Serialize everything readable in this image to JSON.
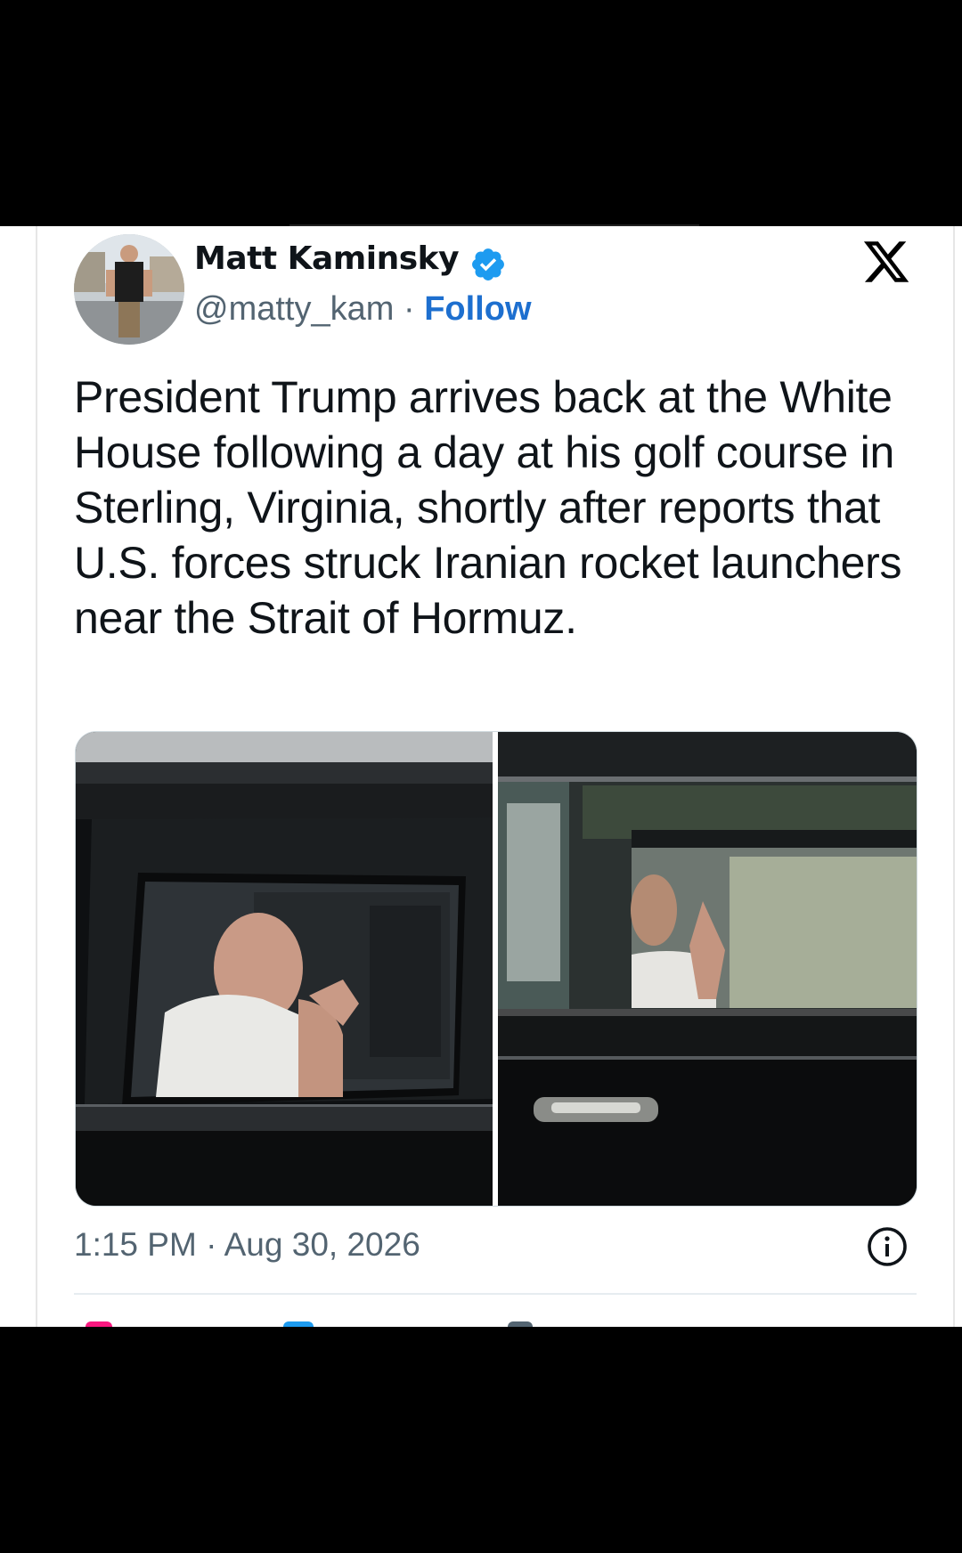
{
  "tweet": {
    "author_name": "Matt Kaminsky",
    "handle": "@matty_kam",
    "separator": "·",
    "follow_label": "Follow",
    "text": "President Trump arrives back at the White House following a day at his golf course in Sterling, Virginia, shortly after reports that U.S. forces struck Iranian rocket launchers near the Strait of Hormuz.",
    "timestamp": "1:15 PM · Aug 30, 2026",
    "media_count": 2
  },
  "icons": {
    "verified": "verified-badge-icon",
    "platform": "x-logo-icon",
    "info": "info-icon"
  },
  "colors": {
    "text_primary": "#0f1419",
    "text_secondary": "#536471",
    "link": "#1d6fcf",
    "verified": "#1d9bf0",
    "background": "#ffffff",
    "frame": "#000000"
  }
}
